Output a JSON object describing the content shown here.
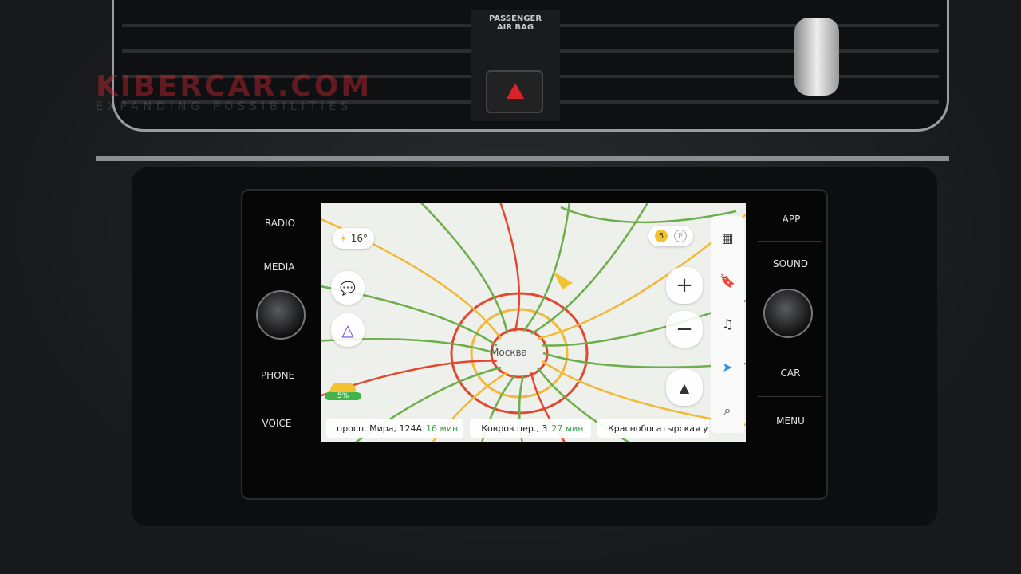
{
  "watermark": {
    "brand": "KIBERCAR.COM",
    "tagline": "EXPANDING POSSIBILITIES"
  },
  "airbag": {
    "line1": "PASSENGER",
    "line2": "AIR BAG"
  },
  "head_unit": {
    "left_buttons": [
      "RADIO",
      "MEDIA",
      "PHONE",
      "VOICE"
    ],
    "right_buttons": [
      "APP",
      "SOUND",
      "CAR",
      "MENU"
    ]
  },
  "map": {
    "weather": {
      "icon": "sun-icon",
      "temp": "16°"
    },
    "city_label": "Москва",
    "alerts_count": "5",
    "parking_label": "P",
    "user_level": "5%",
    "zoom_in": "+",
    "zoom_out": "−",
    "destinations": [
      {
        "address": "просп. Мира, 124А",
        "eta": "16 мин."
      },
      {
        "address": "Ковров пер., 3",
        "eta": "27 мин."
      },
      {
        "address": "Краснобогатырская ул",
        "eta": ""
      }
    ],
    "colors": {
      "traffic_green": "#6cae4a",
      "traffic_yellow": "#f1b93a",
      "traffic_red": "#e2482f",
      "nav_arrow": "#f2c230",
      "accent_blue": "#2f8fe6",
      "alice": "#7b4fe0"
    }
  }
}
